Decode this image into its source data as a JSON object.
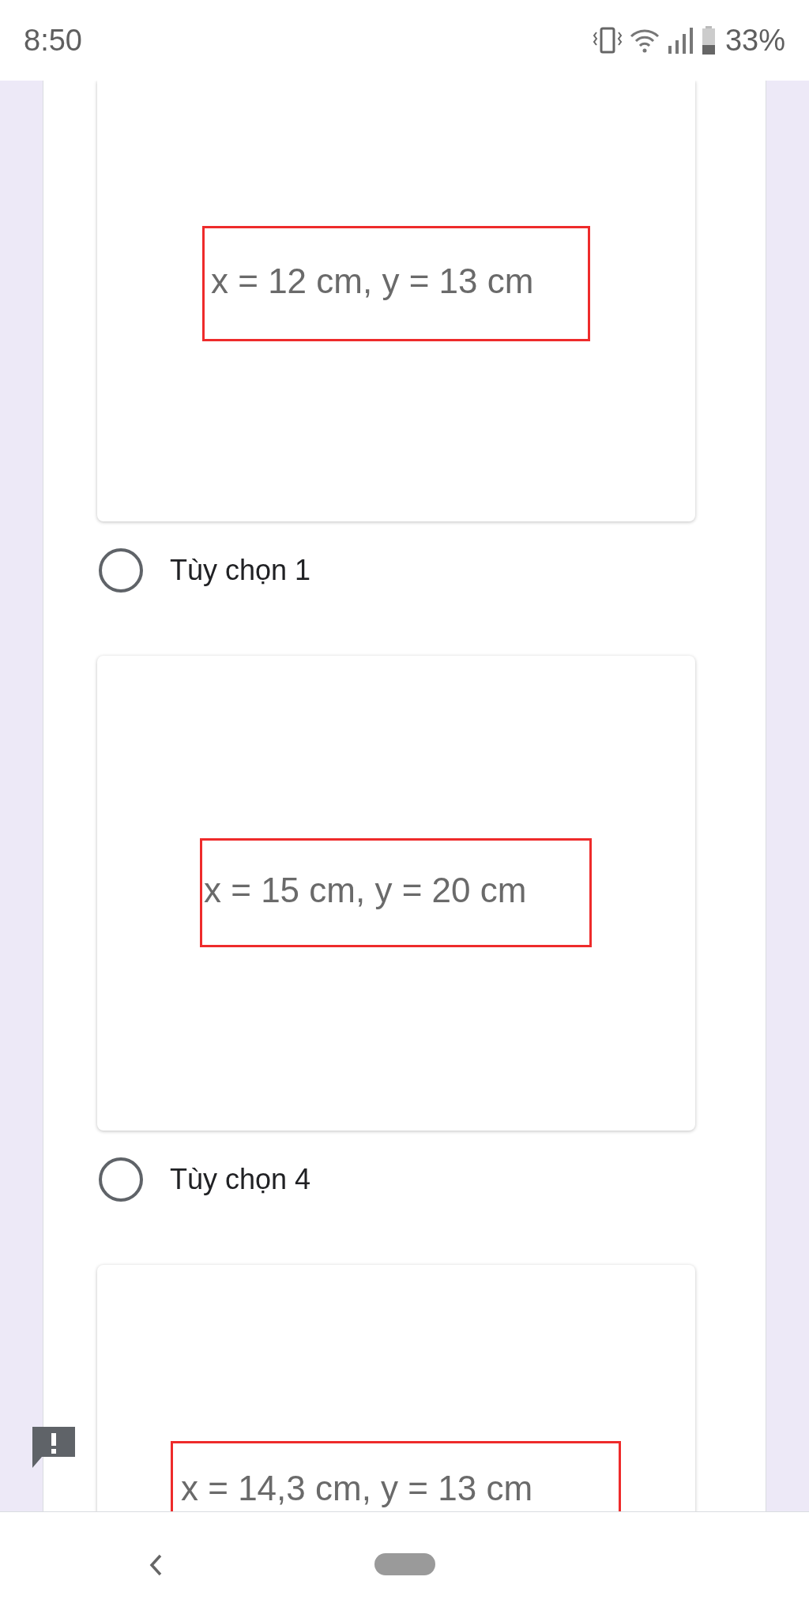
{
  "status_bar": {
    "time": "8:50",
    "battery": "33%"
  },
  "questions": [
    {
      "image_text": "x = 12 cm, y = 13 cm",
      "option": {
        "label": "Tùy chọn 1",
        "selected": false
      }
    },
    {
      "image_text": "x = 15 cm, y = 20 cm",
      "option": {
        "label": "Tùy chọn 4",
        "selected": false
      }
    },
    {
      "image_text": "x = 14,3 cm, y = 13 cm"
    }
  ]
}
